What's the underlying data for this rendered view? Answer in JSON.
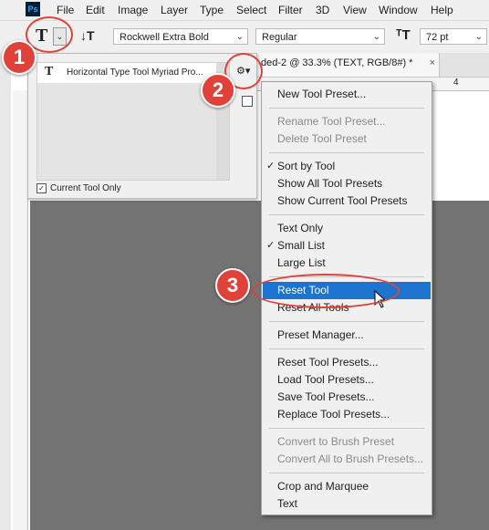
{
  "app": {
    "logo_text": "Ps"
  },
  "menubar": {
    "items": [
      "File",
      "Edit",
      "Image",
      "Layer",
      "Type",
      "Select",
      "Filter",
      "3D",
      "View",
      "Window",
      "Help"
    ]
  },
  "options_bar": {
    "font_family": "Rockwell Extra Bold",
    "font_style": "Regular",
    "font_size": "72 pt"
  },
  "document_tab": {
    "title": "ded-2 @ 33.3% (TEXT, RGB/8#) *"
  },
  "ruler": {
    "label": "4"
  },
  "preset_panel": {
    "item_label": "Horizontal Type Tool Myriad Pro...",
    "current_tool_only_label": "Current Tool Only",
    "current_tool_only_checked": true
  },
  "menu": {
    "items": [
      {
        "label": "New Tool Preset...",
        "disabled": false,
        "checked": false
      },
      {
        "label": "Rename Tool Preset...",
        "disabled": true,
        "checked": false
      },
      {
        "label": "Delete Tool Preset",
        "disabled": true,
        "checked": false
      },
      {
        "label": "Sort by Tool",
        "disabled": false,
        "checked": true
      },
      {
        "label": "Show All Tool Presets",
        "disabled": false,
        "checked": false
      },
      {
        "label": "Show Current Tool Presets",
        "disabled": false,
        "checked": false
      },
      {
        "label": "Text Only",
        "disabled": false,
        "checked": false
      },
      {
        "label": "Small List",
        "disabled": false,
        "checked": true
      },
      {
        "label": "Large List",
        "disabled": false,
        "checked": false
      },
      {
        "label": "Reset Tool",
        "disabled": false,
        "checked": false,
        "highlighted": true
      },
      {
        "label": "Reset All Tools",
        "disabled": false,
        "checked": false
      },
      {
        "label": "Preset Manager...",
        "disabled": false,
        "checked": false
      },
      {
        "label": "Reset Tool Presets...",
        "disabled": false,
        "checked": false
      },
      {
        "label": "Load Tool Presets...",
        "disabled": false,
        "checked": false
      },
      {
        "label": "Save Tool Presets...",
        "disabled": false,
        "checked": false
      },
      {
        "label": "Replace Tool Presets...",
        "disabled": false,
        "checked": false
      },
      {
        "label": "Convert to Brush Preset",
        "disabled": true,
        "checked": false
      },
      {
        "label": "Convert All to Brush Presets...",
        "disabled": true,
        "checked": false
      },
      {
        "label": "Crop and Marquee",
        "disabled": false,
        "checked": false
      },
      {
        "label": "Text",
        "disabled": false,
        "checked": false
      }
    ]
  },
  "annotations": {
    "step1": "1",
    "step2": "2",
    "step3": "3"
  },
  "colors": {
    "annotation": "#e0423a",
    "highlight": "#1c74cf",
    "canvas": "#737373"
  }
}
